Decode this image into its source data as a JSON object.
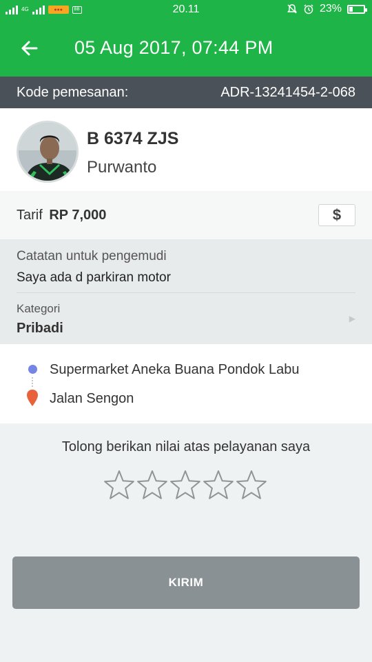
{
  "status_bar": {
    "network": "4G",
    "time": "20.11",
    "battery": "23%",
    "battery_level": 0.23
  },
  "header": {
    "title": "05 Aug 2017, 07:44 PM"
  },
  "order": {
    "label": "Kode pemesanan:",
    "code": "ADR-13241454-2-068"
  },
  "driver": {
    "plate": "B 6374 ZJS",
    "name": "Purwanto"
  },
  "fare": {
    "label": "Tarif",
    "amount": "RP 7,000",
    "cash_symbol": "$"
  },
  "note": {
    "title": "Catatan untuk pengemudi",
    "text": "Saya ada d parkiran motor"
  },
  "category": {
    "title": "Kategori",
    "value": "Pribadi"
  },
  "route": {
    "pickup": "Supermarket Aneka Buana Pondok Labu",
    "dropoff": "Jalan Sengon"
  },
  "rating": {
    "prompt": "Tolong berikan nilai atas pelayanan saya",
    "max": 5,
    "value": 0
  },
  "submit": {
    "label": "KIRIM"
  },
  "colors": {
    "primary": "#1fb447",
    "order_bar": "#4a5159",
    "submit": "#8a9194",
    "pickup": "#7585e3",
    "dropoff": "#e8623c"
  }
}
